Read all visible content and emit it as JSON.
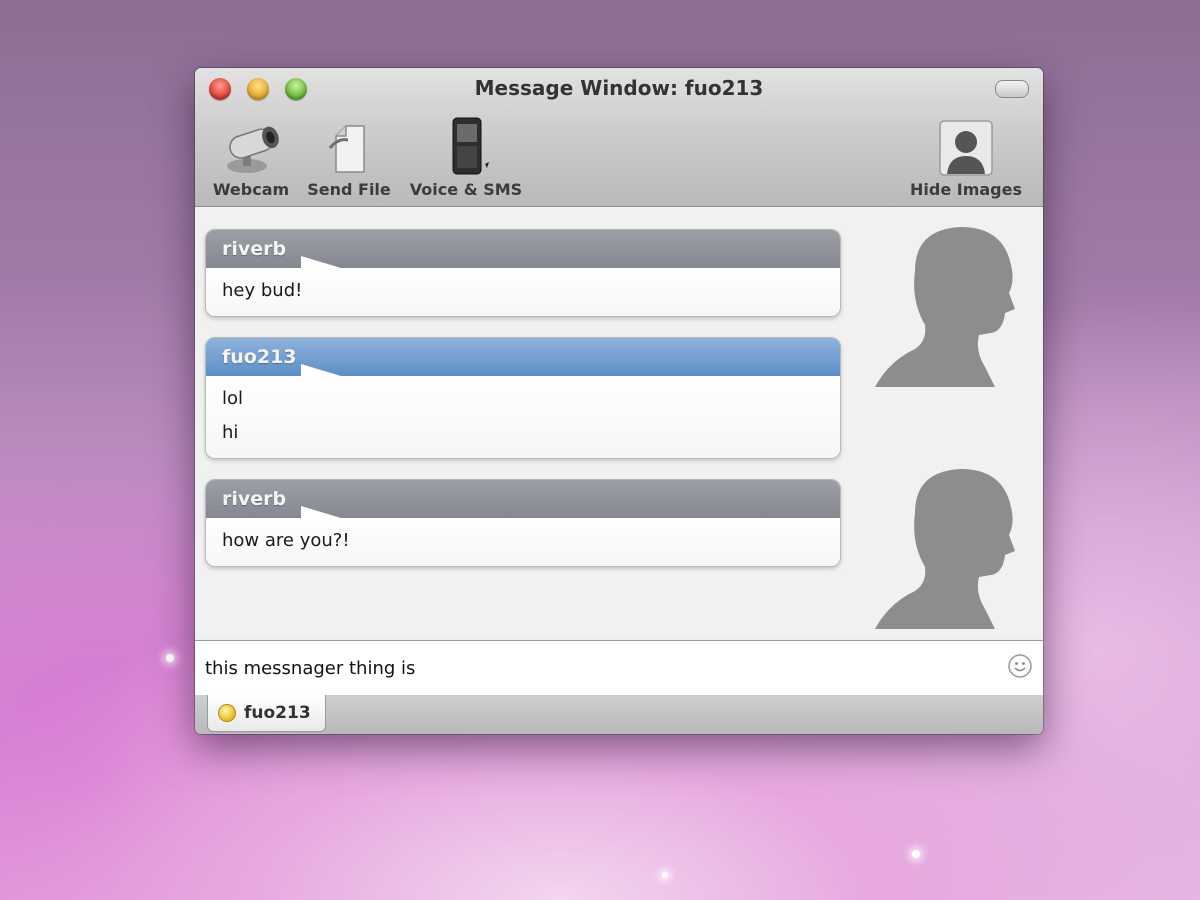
{
  "window": {
    "title": "Message Window: fuo213"
  },
  "toolbar": {
    "webcam_label": "Webcam",
    "send_file_label": "Send File",
    "voice_sms_label": "Voice & SMS",
    "hide_images_label": "Hide Images"
  },
  "messages": [
    {
      "sender": "riverb",
      "style": "gray",
      "lines": [
        "hey bud!"
      ]
    },
    {
      "sender": "fuo213",
      "style": "blue",
      "lines": [
        "lol",
        "hi"
      ]
    },
    {
      "sender": "riverb",
      "style": "gray",
      "lines": [
        "how are you?!"
      ]
    }
  ],
  "composer": {
    "value": "this messnager thing is"
  },
  "tabs": [
    {
      "label": "fuo213"
    }
  ],
  "colors": {
    "incoming_header": "#8f929a",
    "outgoing_header": "#6f9acd"
  }
}
